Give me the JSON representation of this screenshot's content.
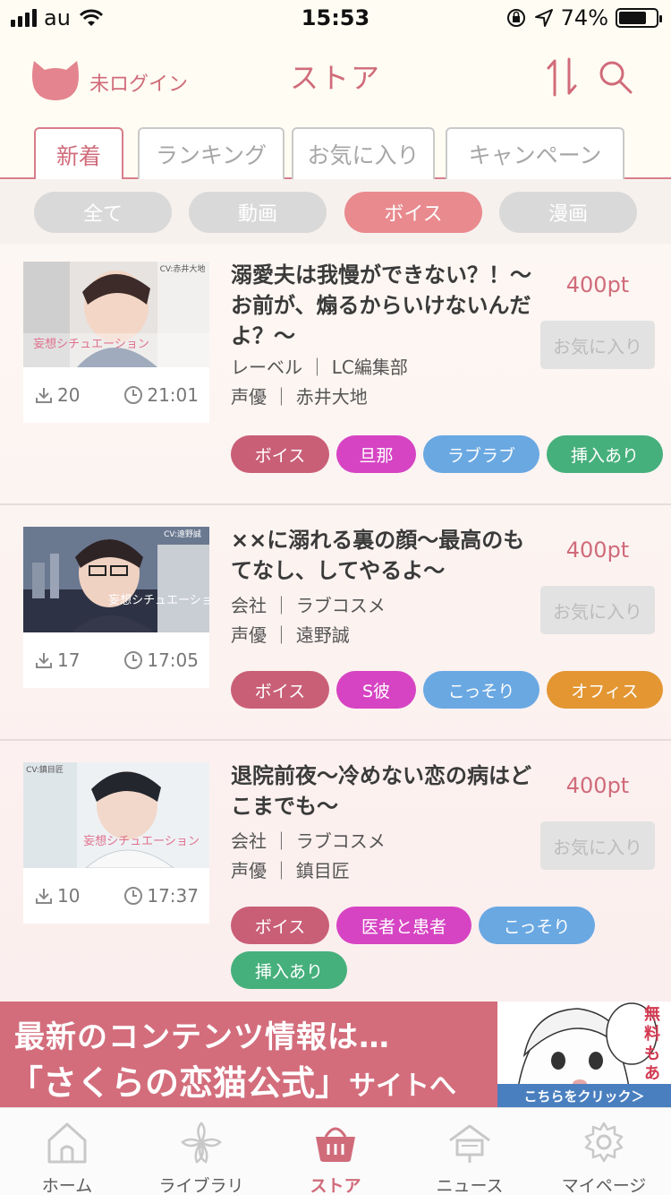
{
  "status_bar": {
    "carrier": "au",
    "time": "15:53",
    "battery": "74%"
  },
  "header": {
    "login_status": "未ログイン",
    "title": "ストア"
  },
  "tabs": [
    {
      "label": "新着",
      "active": true
    },
    {
      "label": "ランキング",
      "active": false
    },
    {
      "label": "お気に入り",
      "active": false
    },
    {
      "label": "キャンペーン",
      "active": false
    }
  ],
  "filters": [
    {
      "label": "全て",
      "active": false
    },
    {
      "label": "動画",
      "active": false
    },
    {
      "label": "ボイス",
      "active": true
    },
    {
      "label": "漫画",
      "active": false
    }
  ],
  "items": [
    {
      "title": "溺愛夫は我慢ができない？！〜お前が、煽るからいけないんだよ？〜",
      "info1": "レーベル ｜ LC編集部",
      "info2": "声優 ｜ 赤井大地",
      "price": "400pt",
      "fav_label": "お気に入り",
      "downloads": "20",
      "duration": "21:01",
      "thumb_cv": "CV:赤井大地",
      "thumb_logo": "妄想シチュエーション",
      "tags": [
        "ボイス",
        "旦那",
        "ラブラブ",
        "挿入あり"
      ]
    },
    {
      "title": "××に溺れる裏の顔〜最高のもてなし、してやるよ〜",
      "info1": "会社 ｜ ラブコスメ",
      "info2": "声優 ｜ 遠野誠",
      "price": "400pt",
      "fav_label": "お気に入り",
      "downloads": "17",
      "duration": "17:05",
      "thumb_cv": "CV:遠野誠",
      "thumb_logo": "妄想シチュエーション",
      "tags": [
        "ボイス",
        "S彼",
        "こっそり",
        "オフィス"
      ]
    },
    {
      "title": "退院前夜〜冷めない恋の病はどこまでも〜",
      "info1": "会社 ｜ ラブコスメ",
      "info2": "声優 ｜ 鎮目匠",
      "price": "400pt",
      "fav_label": "お気に入り",
      "downloads": "10",
      "duration": "17:37",
      "thumb_cv": "CV:鎮目匠",
      "thumb_logo": "妄想シチュエーション",
      "tags": [
        "ボイス",
        "医者と患者",
        "こっそり",
        "挿入あり"
      ]
    }
  ],
  "banner": {
    "line1": "最新のコンテンツ情報は…",
    "line2": "「さくらの恋猫公式」",
    "line2_suffix": "サイトへ",
    "art_text": "無料もある!?",
    "cta": "こちらをクリック＞"
  },
  "nav": [
    {
      "label": "ホーム",
      "icon": "home-icon",
      "active": false
    },
    {
      "label": "ライブラリ",
      "icon": "sakura-icon",
      "active": false
    },
    {
      "label": "ストア",
      "icon": "basket-icon",
      "active": true
    },
    {
      "label": "ニュース",
      "icon": "news-house-icon",
      "active": false
    },
    {
      "label": "マイページ",
      "icon": "gear-icon",
      "active": false
    }
  ],
  "colors": {
    "accent": "#d06b7a",
    "tag_voice": "#c95f77",
    "tag_magenta": "#d644c3",
    "tag_blue": "#6aa8e2",
    "tag_green": "#46b07c",
    "tag_orange": "#e39632"
  }
}
